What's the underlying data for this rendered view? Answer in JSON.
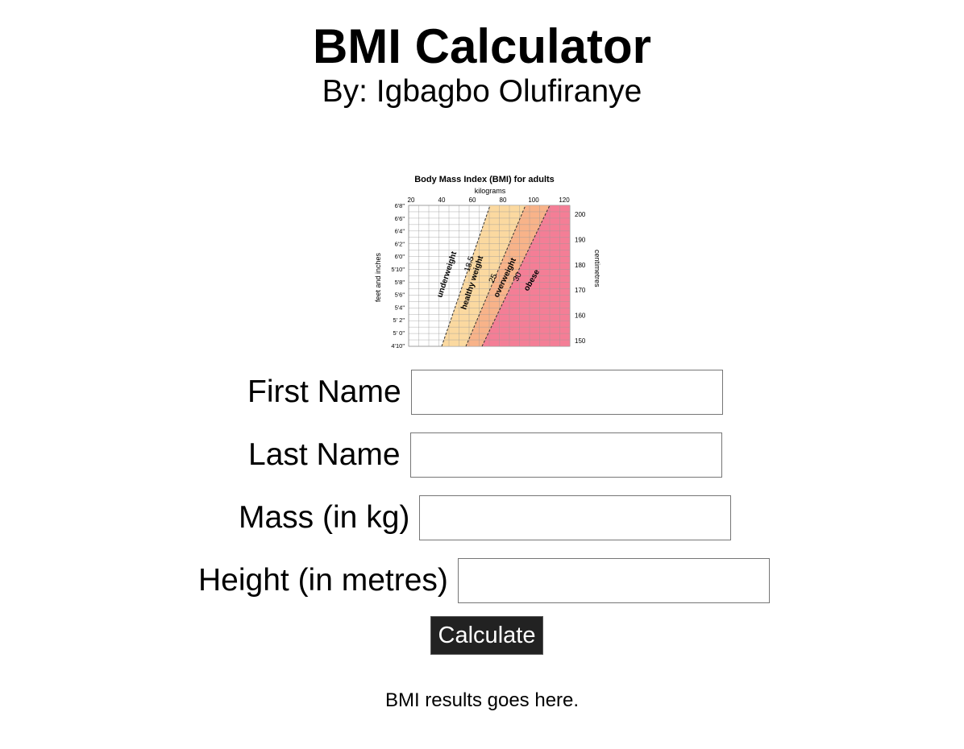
{
  "header": {
    "title": "BMI Calculator",
    "author": "By: Igbagbo Olufiranye"
  },
  "chart_image": {
    "title": "Body Mass Index (BMI) for adults",
    "top_axis_label": "kilograms",
    "top_ticks": [
      "20",
      "40",
      "60",
      "80",
      "100",
      "120"
    ],
    "left_axis_label": "feet and inches",
    "left_ticks": [
      "6'8\"",
      "6'6\"",
      "6'4\"",
      "6'2\"",
      "6'0\"",
      "5'10\"",
      "5'8\"",
      "5'6\"",
      "5'4\"",
      "5' 2\"",
      "5' 0\"",
      "4'10\""
    ],
    "right_axis_label": "centimetres",
    "right_ticks": [
      "200",
      "190",
      "180",
      "170",
      "160",
      "150"
    ],
    "zones": [
      {
        "label": "underweight",
        "color": "#ffffff"
      },
      {
        "label": "healthy weight",
        "color": "#fbd9a0"
      },
      {
        "label": "overweight",
        "color": "#f8b389"
      },
      {
        "label": "obese",
        "color": "#f47e96"
      }
    ],
    "thresholds": [
      "18.5",
      "25",
      "30"
    ]
  },
  "form": {
    "first_name_label": "First Name",
    "last_name_label": "Last Name",
    "mass_label": "Mass (in kg)",
    "height_label": "Height (in metres)",
    "first_name_value": "",
    "last_name_value": "",
    "mass_value": "",
    "height_value": "",
    "calculate_label": "Calculate"
  },
  "result": {
    "text": "BMI results goes here."
  }
}
